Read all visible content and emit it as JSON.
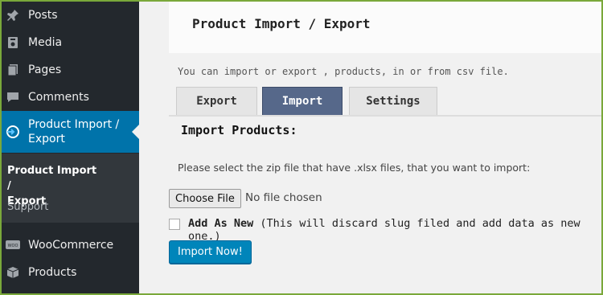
{
  "sidebar": {
    "items": [
      {
        "label": "Posts",
        "icon": "pin-icon"
      },
      {
        "label": "Media",
        "icon": "media-icon"
      },
      {
        "label": "Pages",
        "icon": "pages-icon"
      },
      {
        "label": "Comments",
        "icon": "comments-icon"
      },
      {
        "label": "Product Import /\nExport",
        "icon": "import-export-icon"
      },
      {
        "label": "WooCommerce",
        "icon": "woocommerce-icon"
      },
      {
        "label": "Products",
        "icon": "products-icon"
      }
    ],
    "submenu": {
      "current": "Product Import /\nExport",
      "support": "Support"
    }
  },
  "main": {
    "title": "Product Import / Export",
    "description": "You can import or export , products, in or from csv file.",
    "tabs": [
      {
        "label": "Export"
      },
      {
        "label": "Import"
      },
      {
        "label": "Settings"
      }
    ],
    "section_heading": "Import Products:",
    "instructions": "Please select the zip file that have .xlsx files, that you want to import:",
    "file_button": "Choose File",
    "file_status": "No file chosen",
    "add_as_new_label": "Add As New",
    "add_as_new_note": "(This will discard slug filed and add data as new one.)",
    "submit_label": "Import Now!"
  },
  "colors": {
    "sidebar_bg": "#23282d",
    "active_menu": "#0073aa",
    "active_tab": "#56688a",
    "primary_button": "#0085ba",
    "frame_border": "#7aa83a"
  }
}
